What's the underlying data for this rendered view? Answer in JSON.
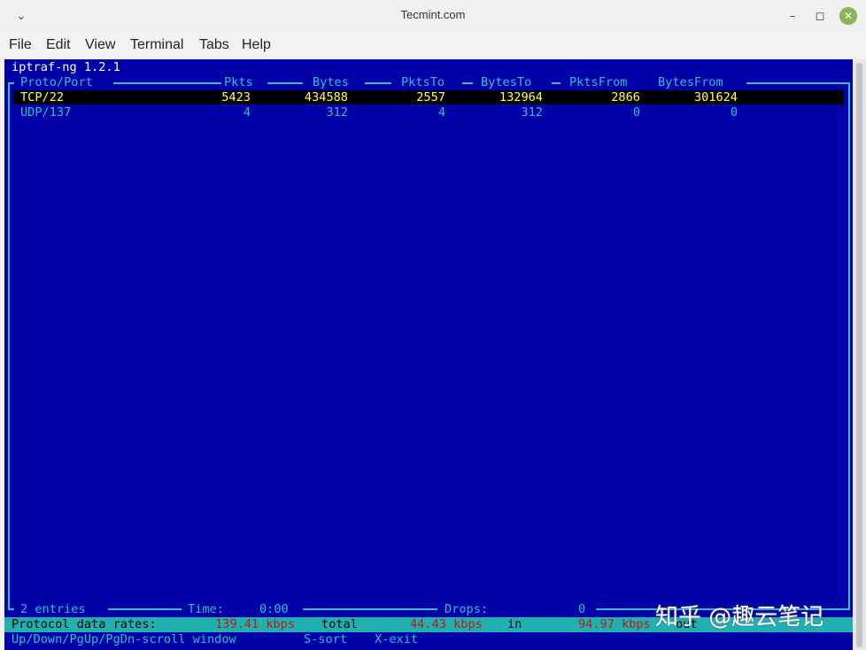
{
  "window": {
    "title": "Tecmint.com",
    "menu_icon": "chevron-down",
    "min_icon": "minimize",
    "max_icon": "maximize",
    "close_icon": "close",
    "accent": "#8ab35a"
  },
  "menubar": {
    "items": [
      {
        "label": "File"
      },
      {
        "label": "Edit"
      },
      {
        "label": "View"
      },
      {
        "label": "Terminal"
      },
      {
        "label": "Tabs"
      },
      {
        "label": "Help"
      }
    ]
  },
  "terminal": {
    "app_title": "iptraf-ng 1.2.1",
    "columns": [
      "Proto/Port",
      "Pkts",
      "Bytes",
      "PktsTo",
      "BytesTo",
      "PktsFrom",
      "BytesFrom"
    ],
    "rows": [
      {
        "proto": "TCP/22",
        "pkts": "5423",
        "bytes": "434588",
        "pkts_to": "2557",
        "bytes_to": "132964",
        "pkts_from": "2866",
        "bytes_from": "301624",
        "selected": true
      },
      {
        "proto": "UDP/137",
        "pkts": "4",
        "bytes": "312",
        "pkts_to": "4",
        "bytes_to": "312",
        "pkts_from": "0",
        "bytes_from": "0",
        "selected": false
      }
    ],
    "footer": {
      "entries": "2 entries",
      "time_label": "Time:",
      "time_value": "0:00",
      "drops_label": "Drops:",
      "drops_value": "0"
    },
    "status": {
      "label": "Protocol data rates:",
      "total_value": "139.41 kbps",
      "total_label": "total",
      "in_value": "44.43 kbps",
      "in_label": "in",
      "out_value": "94.97 kbps",
      "out_label": "out"
    },
    "help": {
      "scroll": "Up/Down/PgUp/PgDn-scroll window",
      "sort": "S-sort",
      "exit": "X-exit"
    },
    "colors": {
      "background": "#0000a8",
      "border": "#29c3c9",
      "selected_text": "#ffff54",
      "status_bar": "#20b0b0",
      "rate_values": "#c21818"
    }
  },
  "watermark": "知乎 @趣云笔记"
}
